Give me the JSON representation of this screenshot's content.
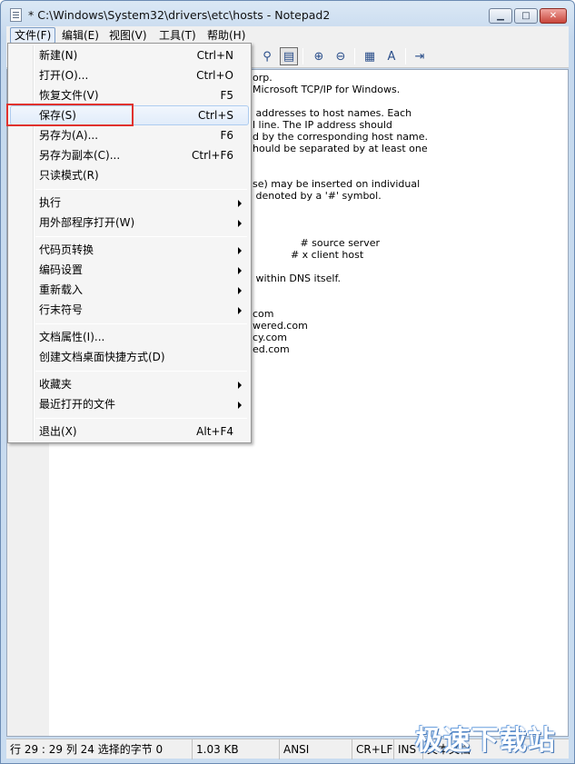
{
  "window": {
    "title": "* C:\\Windows\\System32\\drivers\\etc\\hosts - Notepad2",
    "controls": {
      "minimize": "▁",
      "maximize": "□",
      "close": "✕"
    }
  },
  "menubar": [
    {
      "label": "文件(F)"
    },
    {
      "label": "编辑(E)"
    },
    {
      "label": "视图(V)"
    },
    {
      "label": "工具(T)"
    },
    {
      "label": "帮助(H)"
    }
  ],
  "toolbar": {
    "icons": [
      "find-icon",
      "word-wrap-icon",
      "zoom-in-icon",
      "zoom-out-icon",
      "scheme-icon",
      "font-icon",
      "exit-icon"
    ],
    "glyphs": {
      "find": "⚲",
      "wrap": "▤",
      "zoom_in": "⊕",
      "zoom_out": "⊖",
      "scheme": "▦",
      "font": "A",
      "exit": "⇥"
    }
  },
  "code_lines": [
    "orp.",
    "Microsoft TCP/IP for Windows.",
    "",
    " addresses to host names. Each",
    "l line. The IP address should",
    "d by the corresponding host name.",
    "hould be separated by at least one",
    "",
    "",
    "se) may be inserted on individual",
    " denoted by a '#' symbol.",
    "",
    "",
    "",
    "               # source server",
    "            # x client host",
    "",
    " within DNS itself.",
    "",
    "",
    "com",
    "wered.com",
    "cy.com",
    "ed.com"
  ],
  "file_menu": {
    "items": [
      {
        "label": "新建(N)",
        "shortcut": "Ctrl+N"
      },
      {
        "label": "打开(O)...",
        "shortcut": "Ctrl+O"
      },
      {
        "label": "恢复文件(V)",
        "shortcut": "F5"
      },
      {
        "label": "保存(S)",
        "shortcut": "Ctrl+S"
      },
      {
        "label": "另存为(A)...",
        "shortcut": "F6"
      },
      {
        "label": "另存为副本(C)...",
        "shortcut": "Ctrl+F6"
      },
      {
        "label": "只读模式(R)",
        "shortcut": ""
      },
      {
        "label": "执行",
        "shortcut": ""
      },
      {
        "label": "用外部程序打开(W)",
        "shortcut": ""
      },
      {
        "label": "代码页转换",
        "shortcut": ""
      },
      {
        "label": "编码设置",
        "shortcut": ""
      },
      {
        "label": "重新载入",
        "shortcut": ""
      },
      {
        "label": "行末符号",
        "shortcut": ""
      },
      {
        "label": "文档属性(I)...",
        "shortcut": ""
      },
      {
        "label": "创建文档桌面快捷方式(D)",
        "shortcut": ""
      },
      {
        "label": "收藏夹",
        "shortcut": ""
      },
      {
        "label": "最近打开的文件",
        "shortcut": ""
      },
      {
        "label": "退出(X)",
        "shortcut": "Alt+F4"
      }
    ]
  },
  "status": {
    "position": "行 29 : 29   列 24   选择的字节 0",
    "size": "1.03 KB",
    "encoding": "ANSI",
    "line_ending": "CR+LF",
    "insert_mode": "INS",
    "scheme": "文本文档"
  },
  "watermark": "极速下载站",
  "colors": {
    "highlight_border": "#e0322d",
    "menu_hover": "#aeccf0"
  }
}
